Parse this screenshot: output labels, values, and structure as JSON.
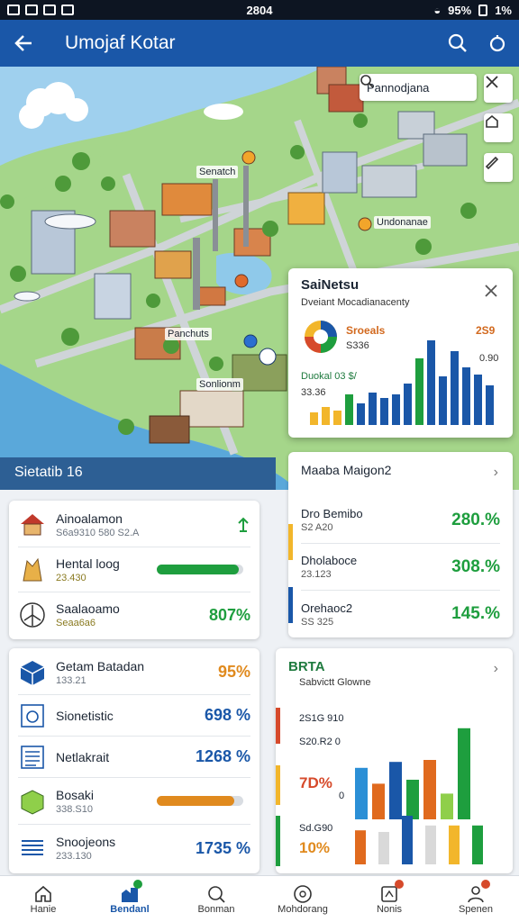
{
  "status_bar": {
    "time": "2804",
    "battery": "95%",
    "extra": "1%"
  },
  "app_bar": {
    "title": "Umojaf Kotar",
    "back_icon": "back-arrow-icon",
    "actions": [
      "search-icon",
      "location-icon"
    ]
  },
  "map": {
    "search_placeholder": "Pannodjana",
    "labels": [
      "Senatch",
      "Undonanae",
      "Panchuts",
      "Sonlionm"
    ],
    "tool_buttons": [
      "close-crossed-icon",
      "home-shield-icon",
      "pen-icon"
    ]
  },
  "popup": {
    "title": "SaiNetsu",
    "subtitle": "Dveiant Mocadianacenty",
    "pie_label": "Sroeals",
    "pie_sub": "S336",
    "value_orange": "2S9",
    "axis_tick": "0.90",
    "lower_label": "Duokal 03 $/",
    "lower_sub": "33.36"
  },
  "section_header": "Sietatib 16",
  "left_card_1": {
    "rows": [
      {
        "name": "Ainoalamon",
        "sub": "S6a9310 580 S2.A",
        "icon": "house-icon",
        "action_icon": "up-arrow-icon"
      },
      {
        "name": "Hental loog",
        "sub": "23.430",
        "icon": "building-icon",
        "progress": 0.95
      },
      {
        "name": "Saalaoamo",
        "sub": "Seaa6a6",
        "icon": "windmill-icon",
        "value": "807%"
      }
    ]
  },
  "right_card_1": {
    "title": "Maaba Maigon2",
    "rows": [
      {
        "name": "Dro Bemibo",
        "sub": "S2 A20",
        "value": "280.%"
      },
      {
        "name": "Dholaboce",
        "sub": "23.123",
        "value": "308.%"
      },
      {
        "name": "Orehaoc2",
        "sub": "SS 325",
        "value": "145.%"
      }
    ]
  },
  "left_card_2": {
    "rows": [
      {
        "name": "Getam Batadan",
        "sub": "133.21",
        "icon": "cube-icon",
        "value": "95%",
        "color": "#e08a1e"
      },
      {
        "name": "Sionetistic",
        "sub": "",
        "icon": "gauge-icon",
        "value": "698 %"
      },
      {
        "name": "Netlakrait",
        "sub": "",
        "icon": "document-icon",
        "value": "1268 %"
      },
      {
        "name": "Bosaki",
        "sub": "338.S10",
        "icon": "crate-icon",
        "progress": 0.9
      },
      {
        "name": "Snoojeons",
        "sub": "233.130",
        "icon": "list-icon",
        "value": "1735 %"
      }
    ]
  },
  "right_card_2": {
    "title": "BRTA",
    "subtitle": "Sabvictt Glowne",
    "labels": [
      "2S1G 910",
      "S20.R2 0",
      "7D%",
      "Sd.G90",
      "10%"
    ],
    "zero_tick": "0",
    "chart_data": {
      "type": "bar",
      "series": [
        {
          "values": [
            26,
            18,
            29,
            20,
            30,
            13,
            46,
            21,
            20,
            30,
            24,
            24,
            24
          ]
        }
      ],
      "note": "two bar groups; upper values on a 0-50 scale"
    }
  },
  "colors": {
    "primary": "#1a57a8",
    "accent_green": "#1e9e3e",
    "accent_orange": "#e08a1e"
  },
  "bottom_nav": [
    {
      "label": "Hanie",
      "icon": "home-icon"
    },
    {
      "label": "Bendanl",
      "icon": "city-icon",
      "active": true
    },
    {
      "label": "Bonman",
      "icon": "search-icon"
    },
    {
      "label": "Mohdorang",
      "icon": "compass-icon"
    },
    {
      "label": "Nonis",
      "icon": "notification-icon"
    },
    {
      "label": "Spenen",
      "icon": "profile-icon"
    }
  ]
}
